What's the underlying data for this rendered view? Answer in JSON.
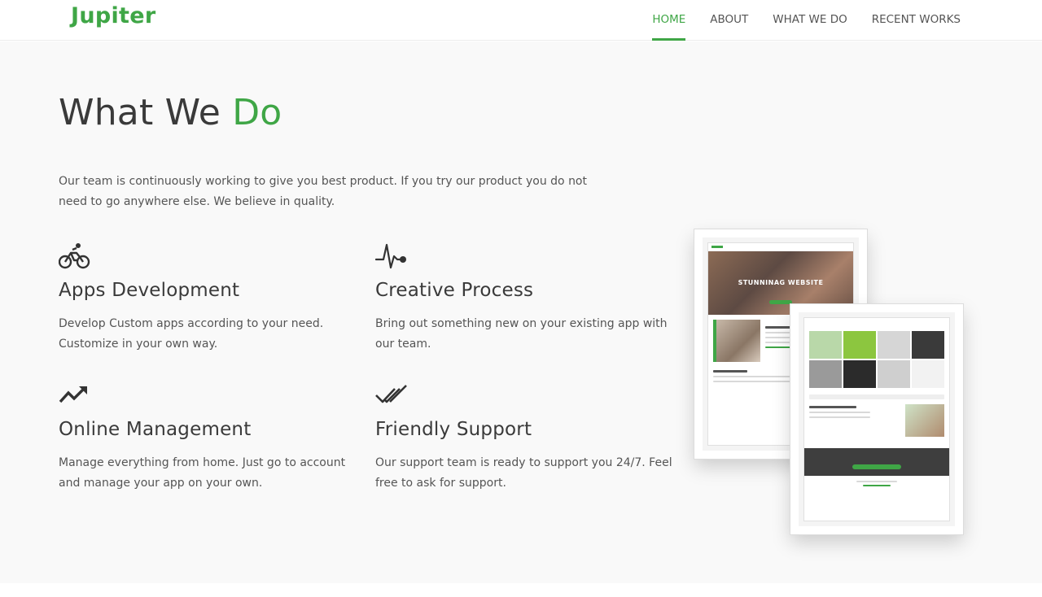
{
  "brand": {
    "logo": "Jupiter",
    "accent": "#3fa646"
  },
  "nav": {
    "items": [
      {
        "label": "HOME",
        "active": true
      },
      {
        "label": "ABOUT",
        "active": false
      },
      {
        "label": "WHAT WE DO",
        "active": false
      },
      {
        "label": "RECENT WORKS",
        "active": false
      }
    ]
  },
  "section": {
    "title_main": "What We ",
    "title_accent": "Do",
    "intro": "Our team is continuously working to give you best product. If you try our product you do not need to go anywhere else. We believe in quality.",
    "features": [
      {
        "icon": "bicycle-icon",
        "title": "Apps Development",
        "text": "Develop Custom apps according to your need. Customize in your own way."
      },
      {
        "icon": "pulse-icon",
        "title": "Creative Process",
        "text": "Bring out something new on your existing app with our team."
      },
      {
        "icon": "trending-up-icon",
        "title": "Online Management",
        "text": "Manage everything from home. Just go to account and manage your app on your own."
      },
      {
        "icon": "double-check-icon",
        "title": "Friendly Support",
        "text": "Our support team is ready to support you 24/7. Feel free to ask for support."
      }
    ],
    "mockup": {
      "hero_text": "STUNNINAG WEBSITE"
    }
  }
}
